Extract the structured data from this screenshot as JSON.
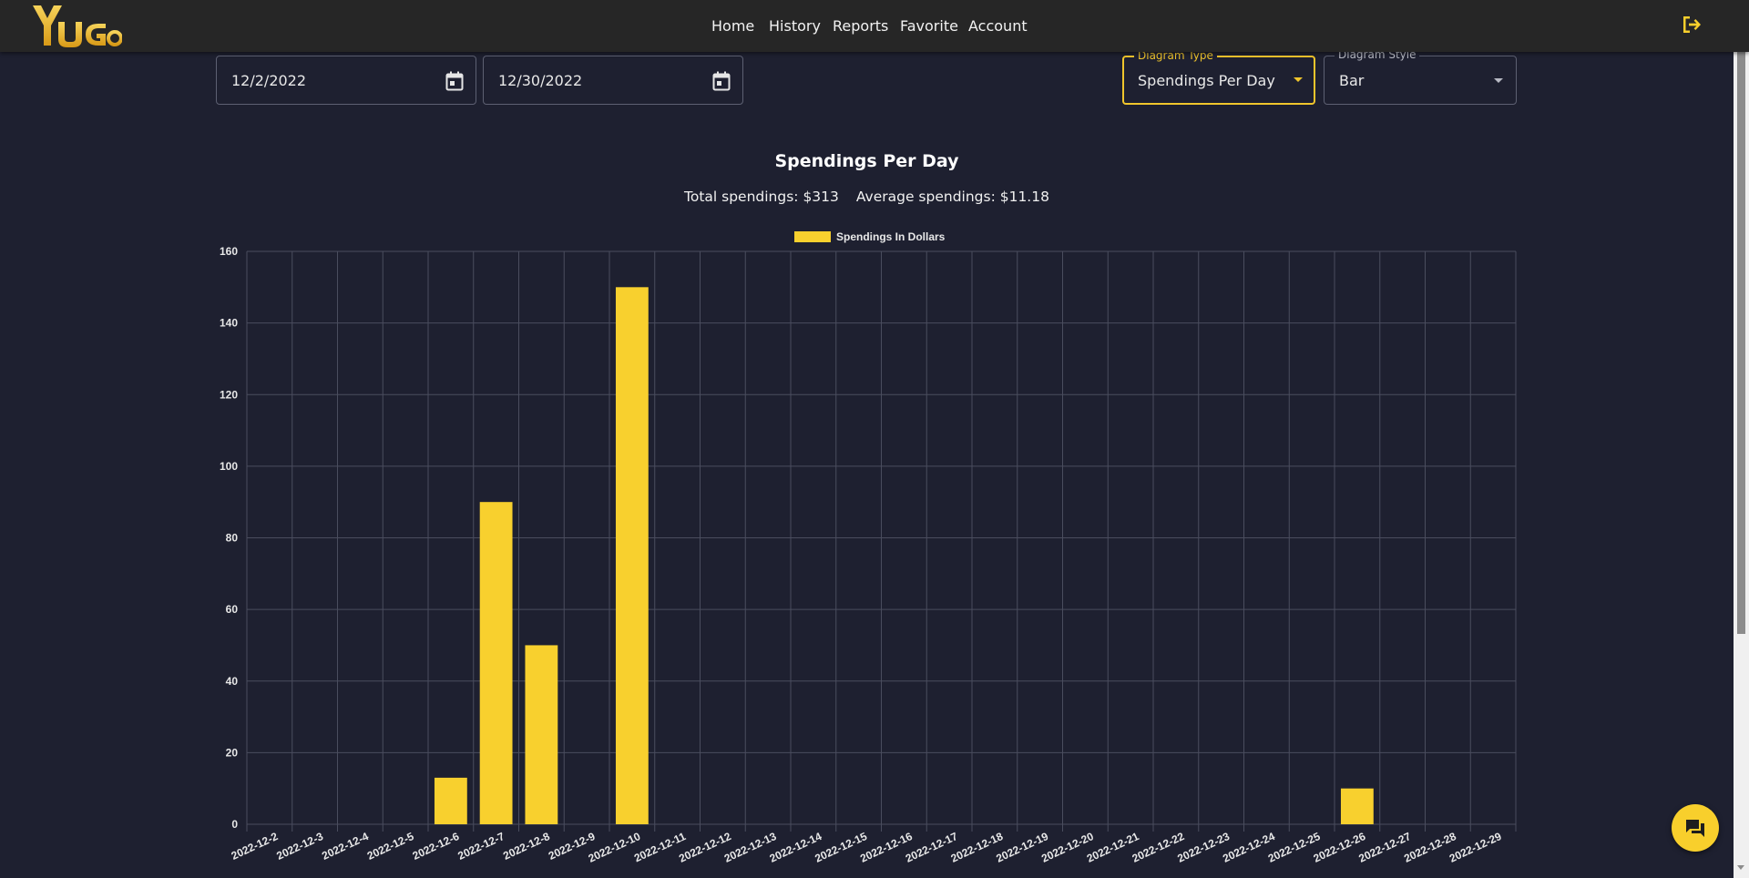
{
  "app": {
    "logo_text": "YuGo"
  },
  "nav": {
    "items": [
      {
        "label": "Home"
      },
      {
        "label": "History"
      },
      {
        "label": "Reports"
      },
      {
        "label": "Favorite"
      },
      {
        "label": "Account"
      }
    ],
    "logout_icon": "logout-icon"
  },
  "filters": {
    "start_date": "12/2/2022",
    "end_date": "12/30/2022",
    "diagram_type": {
      "label": "Diagram Type",
      "value": "Spendings Per Day"
    },
    "diagram_style": {
      "label": "Diagram Style",
      "value": "Bar"
    }
  },
  "summary": {
    "title": "Spendings Per Day",
    "total": "Total spendings: $313",
    "average": "Average spendings: $11.18"
  },
  "colors": {
    "accent": "#f8d02e",
    "background": "#1e2030",
    "topbar": "#262626",
    "grid": "#4a4d5e"
  },
  "chat_icon": "chat-icon",
  "chart_data": {
    "type": "bar",
    "legend": "Spendings In Dollars",
    "legend_position": "top-center",
    "grid": true,
    "ylim": [
      0,
      160
    ],
    "yticks": [
      0,
      20,
      40,
      60,
      80,
      100,
      120,
      140,
      160
    ],
    "categories": [
      "2022-12-2",
      "2022-12-3",
      "2022-12-4",
      "2022-12-5",
      "2022-12-6",
      "2022-12-7",
      "2022-12-8",
      "2022-12-9",
      "2022-12-10",
      "2022-12-11",
      "2022-12-12",
      "2022-12-13",
      "2022-12-14",
      "2022-12-15",
      "2022-12-16",
      "2022-12-17",
      "2022-12-18",
      "2022-12-19",
      "2022-12-20",
      "2022-12-21",
      "2022-12-22",
      "2022-12-23",
      "2022-12-24",
      "2022-12-25",
      "2022-12-26",
      "2022-12-27",
      "2022-12-28",
      "2022-12-29"
    ],
    "values": [
      0,
      0,
      0,
      0,
      13,
      90,
      50,
      0,
      150,
      0,
      0,
      0,
      0,
      0,
      0,
      0,
      0,
      0,
      0,
      0,
      0,
      0,
      0,
      0,
      10,
      0,
      0,
      0
    ]
  }
}
